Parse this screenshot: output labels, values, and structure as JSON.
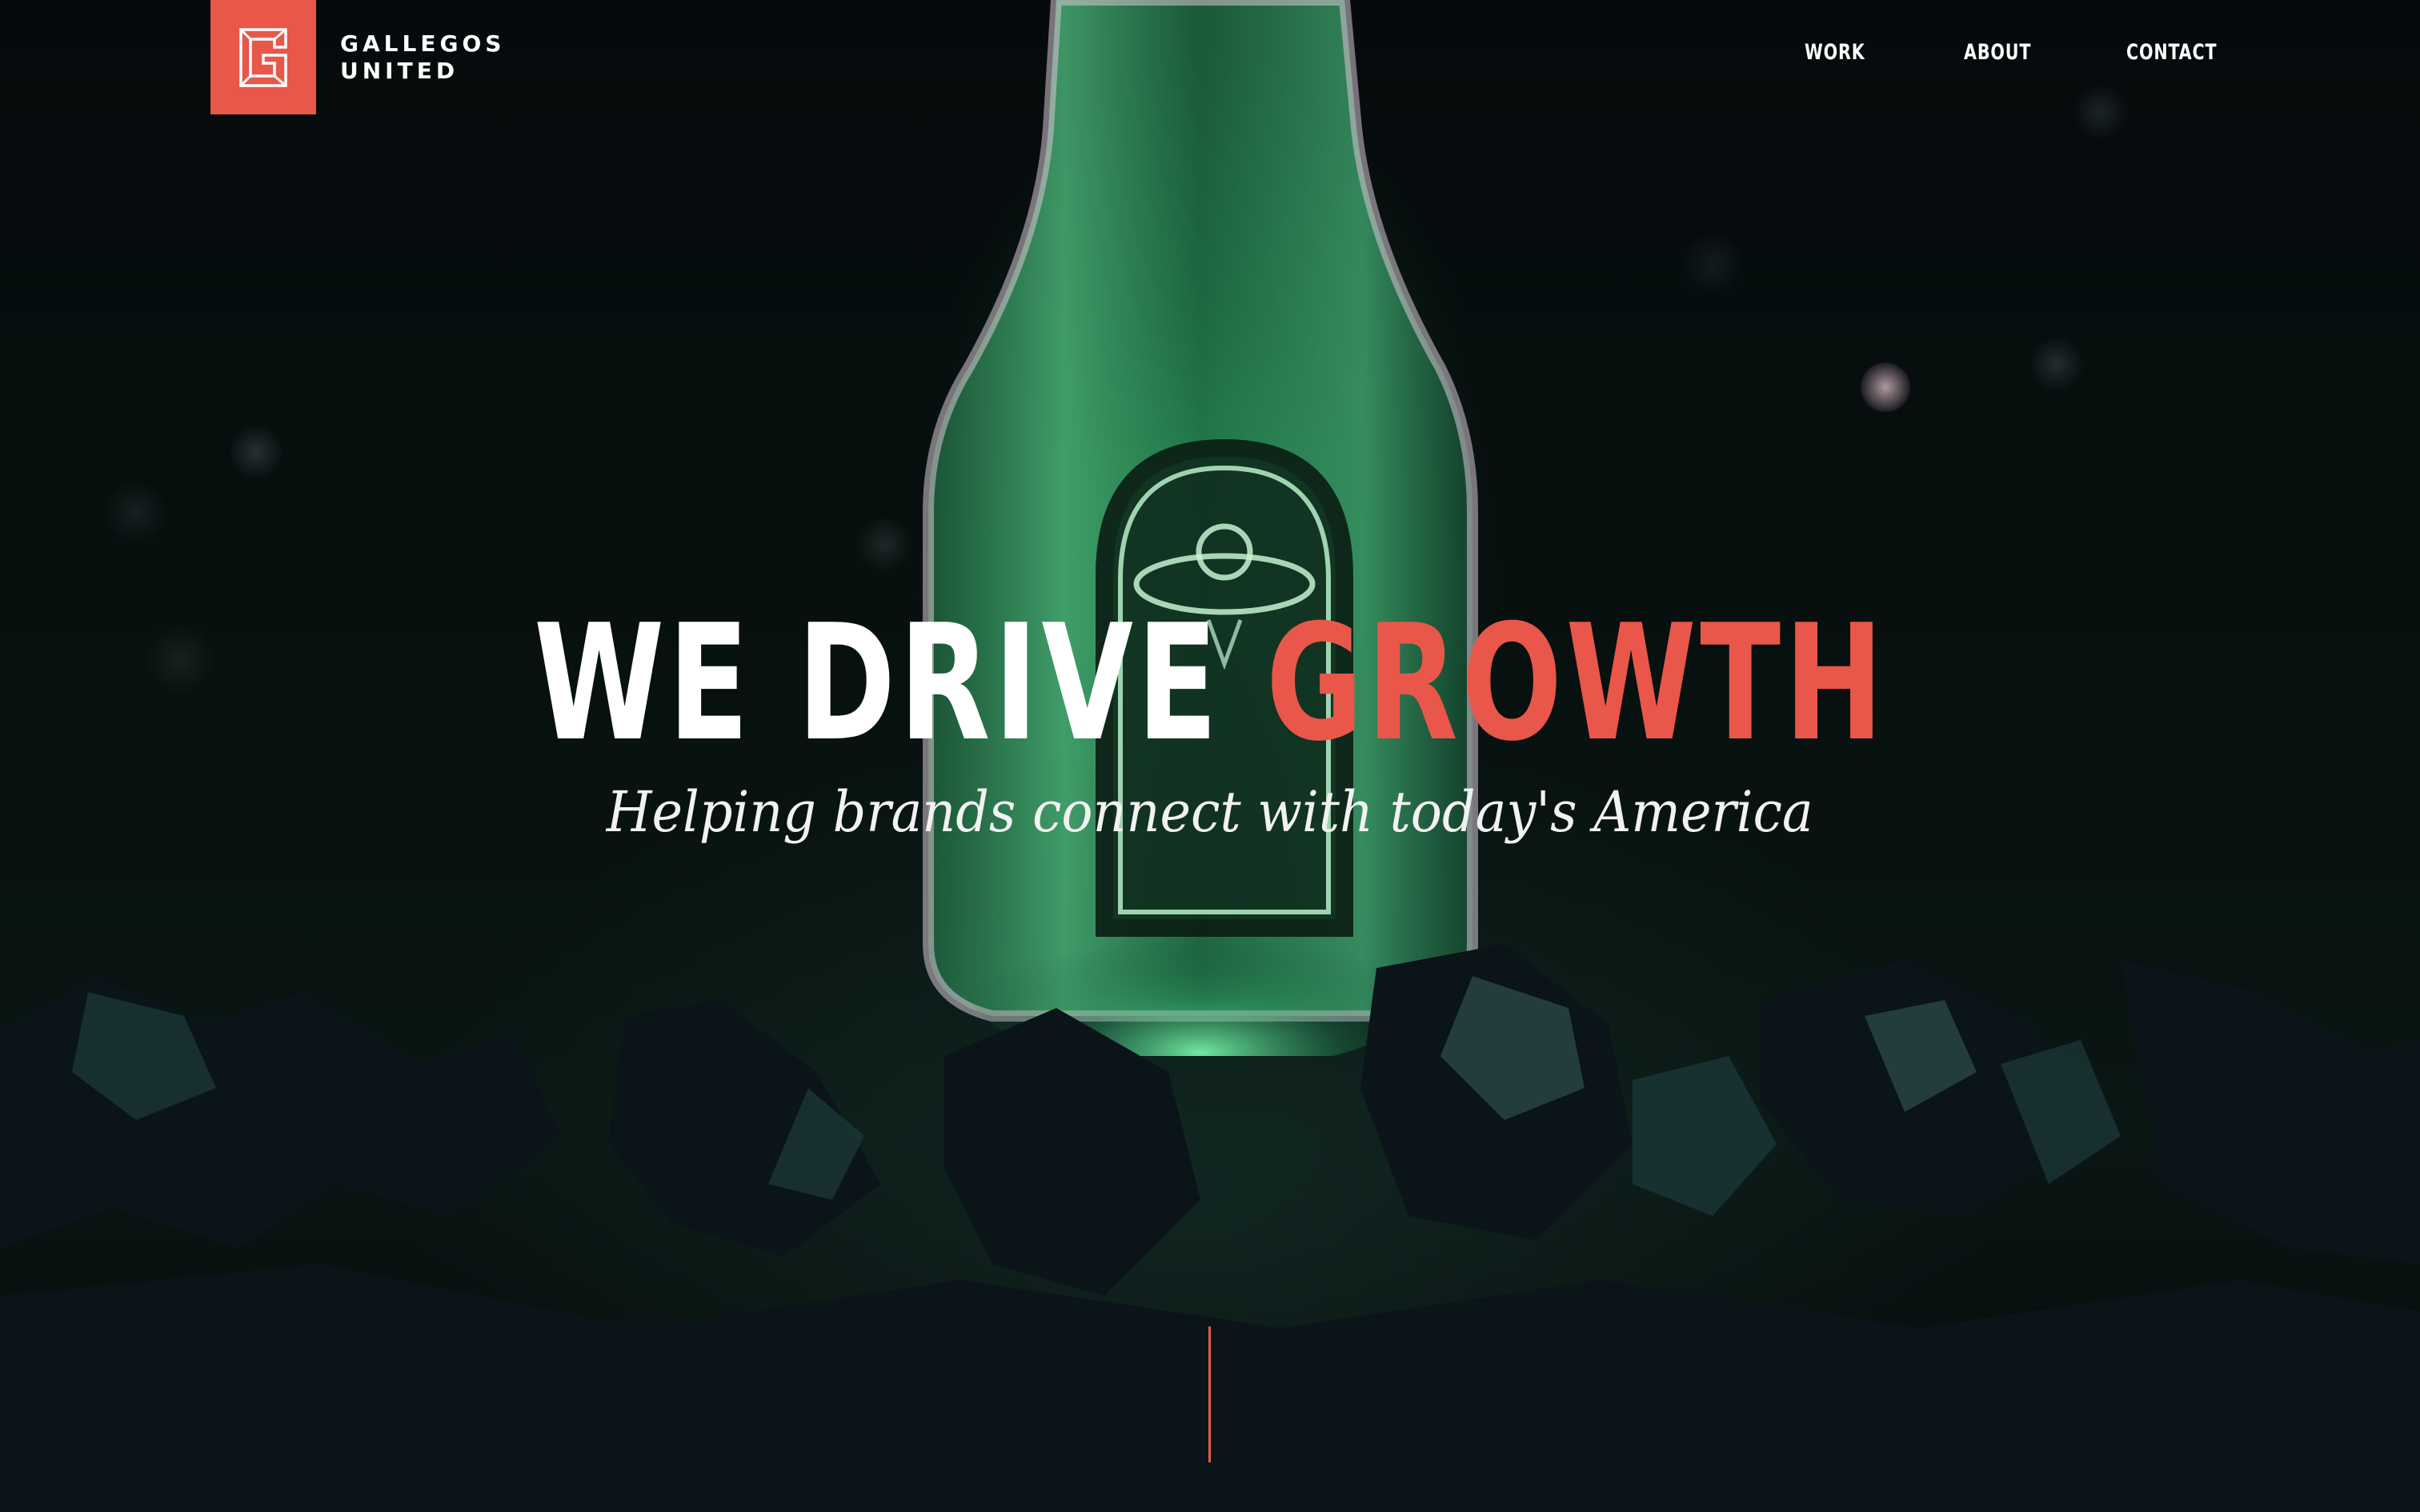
{
  "brand": {
    "name_line1": "GALLEGOS",
    "name_line2": "UNITED",
    "accent_color": "#e9574a"
  },
  "nav": {
    "items": [
      {
        "label": "WORK"
      },
      {
        "label": "ABOUT"
      },
      {
        "label": "CONTACT"
      }
    ]
  },
  "hero": {
    "headline_part1": "WE DRIVE",
    "headline_part2": "GROWTH",
    "subheadline": "Helping brands connect with today's America",
    "background_image": "glowing-bottle-icon"
  }
}
